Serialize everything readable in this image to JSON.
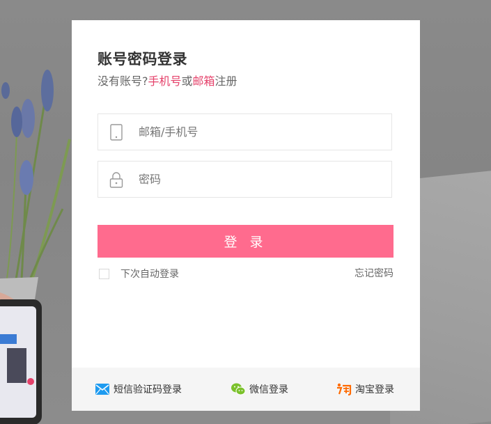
{
  "login": {
    "title": "账号密码登录",
    "subtitle_prefix": "没有账号?",
    "subtitle_phone": "手机号",
    "subtitle_or": "或",
    "subtitle_email": "邮箱",
    "subtitle_suffix": "注册",
    "account_placeholder": "邮箱/手机号",
    "password_placeholder": "密码",
    "submit_label": "登 录",
    "remember_label": "下次自动登录",
    "forgot_label": "忘记密码"
  },
  "footer": {
    "sms_label": "短信验证码登录",
    "wechat_label": "微信登录",
    "taobao_label": "淘宝登录"
  },
  "icons": {
    "account": "phone-icon",
    "password": "lock-icon",
    "sms": "envelope-icon",
    "wechat": "wechat-icon",
    "taobao": "taobao-icon"
  },
  "colors": {
    "accent": "#e5416a",
    "button": "#ff6b8e",
    "sms": "#1e9bf0",
    "wechat": "#7bc12b",
    "taobao": "#ff6a00"
  }
}
